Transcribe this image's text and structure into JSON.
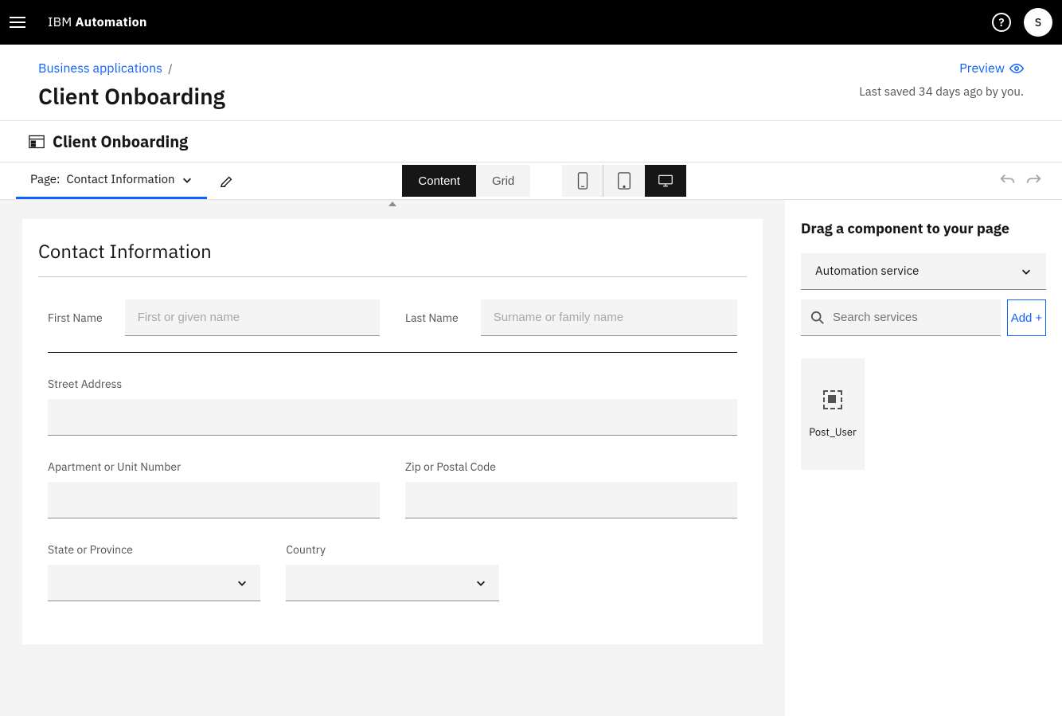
{
  "header": {
    "brand_prefix": "IBM",
    "brand_suffix": "Automation",
    "avatar_initial": "S"
  },
  "breadcrumb": {
    "link_text": "Business applications",
    "separator": "/"
  },
  "page": {
    "title": "Client Onboarding",
    "preview_label": "Preview",
    "last_saved": "Last saved 34 days ago by you."
  },
  "sub_header": {
    "title": "Client Onboarding"
  },
  "toolbar": {
    "page_label": "Page:",
    "page_value": "Contact Information",
    "seg_content": "Content",
    "seg_grid": "Grid"
  },
  "form": {
    "title": "Contact Information",
    "first_name_label": "First Name",
    "first_name_placeholder": "First or given name",
    "last_name_label": "Last Name",
    "last_name_placeholder": "Surname or family name",
    "street_label": "Street Address",
    "apt_label": "Apartment or Unit Number",
    "zip_label": "Zip or Postal Code",
    "state_label": "State or Province",
    "country_label": "Country"
  },
  "right_panel": {
    "title": "Drag a component to your page",
    "dropdown_value": "Automation service",
    "search_placeholder": "Search services",
    "add_label": "Add +",
    "component_name": "Post_User"
  }
}
